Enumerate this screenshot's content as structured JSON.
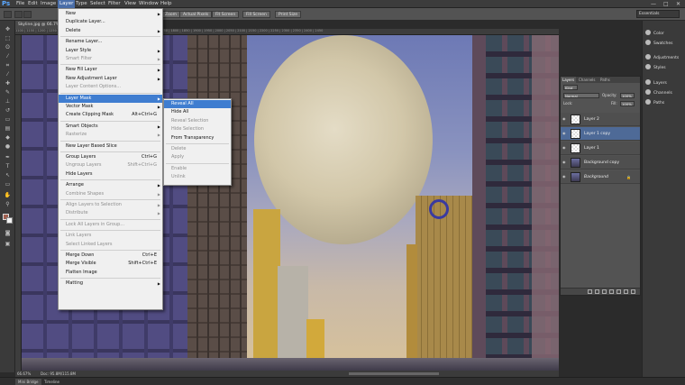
{
  "app": {
    "logo": "Ps"
  },
  "menubar": {
    "items": [
      "File",
      "Edit",
      "Image",
      "Layer",
      "Type",
      "Select",
      "Filter",
      "View",
      "Window",
      "Help"
    ],
    "active": "Layer",
    "window_controls": [
      "—",
      "□",
      "✕"
    ]
  },
  "optbar": {
    "buttons": [
      "Zoom",
      "Actual Pixels",
      "Fit Screen",
      "Fill Screen",
      "Print Size"
    ],
    "workspace": "Essentials"
  },
  "doc": {
    "tab_title": "Skyline.jpg @ 66.7% (Layer 1 copy, RGB/8) ✕",
    "status_zoom": "66.67%",
    "status_doc": "Doc: 95.8M/115.8M"
  },
  "ruler_top": "1100 | 1150 | 1200 | 1250 | 1300 | 1350 | 1400 | 1450 | 1500 | 1550 | 1600 | 1650 | 1700 | 1750 | 1800 | 1850 | 1900 | 1950 | 2000 | 2050 | 2100 | 2150 | 2200 | 2250 | 2300 | 2350 | 2400 | 2450",
  "bottom_tabs": [
    "Mini Bridge",
    "Timeline"
  ],
  "right_panels": {
    "group1": [
      "Color",
      "Swatches"
    ],
    "group2": [
      "Adjustments",
      "Styles"
    ],
    "group3": [
      "Layers",
      "Channels",
      "Paths"
    ]
  },
  "layers_panel": {
    "tabs": [
      "Layers",
      "Channels",
      "Paths"
    ],
    "filter_kind": "Kind",
    "blend_mode": "Normal",
    "opacity_label": "Opacity:",
    "opacity_value": "100%",
    "lock_label": "Lock:",
    "fill_label": "Fill:",
    "fill_value": "100%",
    "layers": [
      {
        "name": "Layer 2",
        "thumb": "check",
        "selected": false,
        "italic": false
      },
      {
        "name": "Layer 1 copy",
        "thumb": "check",
        "selected": true,
        "italic": false
      },
      {
        "name": "Layer 1",
        "thumb": "check",
        "selected": false,
        "italic": false
      },
      {
        "name": "Background copy",
        "thumb": "img",
        "selected": false,
        "italic": false
      },
      {
        "name": "Background",
        "thumb": "img",
        "selected": false,
        "italic": true,
        "locked": true
      }
    ]
  },
  "layer_menu": {
    "rows": [
      {
        "label": "New",
        "sub": true
      },
      {
        "label": "Duplicate Layer..."
      },
      {
        "label": "Delete",
        "sub": true
      },
      {
        "sep": true
      },
      {
        "label": "Rename Layer..."
      },
      {
        "label": "Layer Style",
        "sub": true
      },
      {
        "label": "Smart Filter",
        "dis": true,
        "sub": true
      },
      {
        "sep": true
      },
      {
        "label": "New Fill Layer",
        "sub": true
      },
      {
        "label": "New Adjustment Layer",
        "sub": true
      },
      {
        "label": "Layer Content Options...",
        "dis": true
      },
      {
        "sep": true
      },
      {
        "label": "Layer Mask",
        "sub": true,
        "hl": true
      },
      {
        "label": "Vector Mask",
        "sub": true
      },
      {
        "label": "Create Clipping Mask",
        "shortcut": "Alt+Ctrl+G"
      },
      {
        "sep": true
      },
      {
        "label": "Smart Objects",
        "sub": true
      },
      {
        "label": "Rasterize",
        "dis": true,
        "sub": true
      },
      {
        "sep": true
      },
      {
        "label": "New Layer Based Slice"
      },
      {
        "sep": true
      },
      {
        "label": "Group Layers",
        "shortcut": "Ctrl+G"
      },
      {
        "label": "Ungroup Layers",
        "shortcut": "Shift+Ctrl+G",
        "dis": true
      },
      {
        "label": "Hide Layers"
      },
      {
        "sep": true
      },
      {
        "label": "Arrange",
        "sub": true
      },
      {
        "label": "Combine Shapes",
        "dis": true,
        "sub": true
      },
      {
        "sep": true
      },
      {
        "label": "Align Layers to Selection",
        "dis": true,
        "sub": true
      },
      {
        "label": "Distribute",
        "dis": true,
        "sub": true
      },
      {
        "sep": true
      },
      {
        "label": "Lock All Layers in Group...",
        "dis": true
      },
      {
        "sep": true
      },
      {
        "label": "Link Layers",
        "dis": true
      },
      {
        "label": "Select Linked Layers",
        "dis": true
      },
      {
        "sep": true
      },
      {
        "label": "Merge Down",
        "shortcut": "Ctrl+E"
      },
      {
        "label": "Merge Visible",
        "shortcut": "Shift+Ctrl+E"
      },
      {
        "label": "Flatten Image"
      },
      {
        "sep": true
      },
      {
        "label": "Matting",
        "sub": true
      }
    ]
  },
  "layer_mask_submenu": {
    "rows": [
      {
        "label": "Reveal All",
        "hl": true
      },
      {
        "label": "Hide All"
      },
      {
        "label": "Reveal Selection",
        "dis": true
      },
      {
        "label": "Hide Selection",
        "dis": true
      },
      {
        "label": "From Transparency"
      },
      {
        "sep": true
      },
      {
        "label": "Delete",
        "dis": true
      },
      {
        "label": "Apply",
        "dis": true
      },
      {
        "sep": true
      },
      {
        "label": "Enable",
        "dis": true
      },
      {
        "label": "Unlink",
        "dis": true
      }
    ]
  },
  "colors": {
    "menu_highlight": "#3f7dd0",
    "ps_blue": "#5aa7ff",
    "selected_layer": "#4e6a97"
  }
}
